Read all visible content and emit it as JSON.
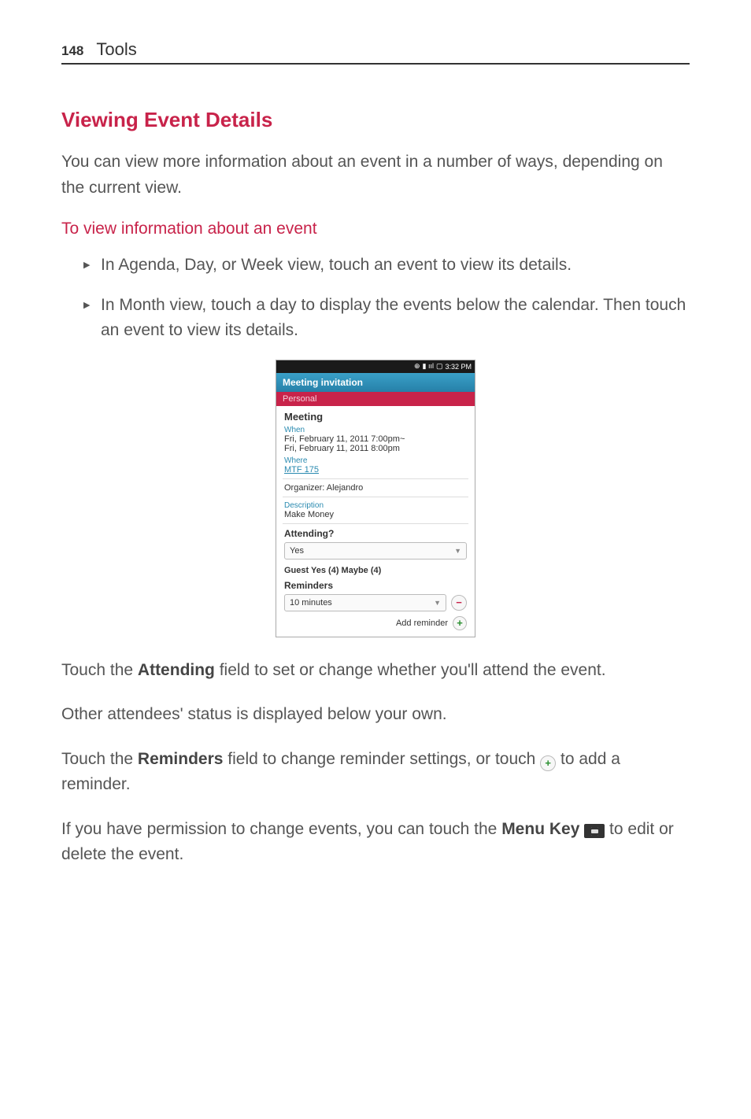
{
  "header": {
    "page_number": "148",
    "section": "Tools"
  },
  "section_heading": "Viewing Event Details",
  "intro_para": "You can view more information about an event in a number of ways, depending on the current view.",
  "sub_heading": "To view information about an event",
  "bullets": [
    "In Agenda, Day, or Week view, touch an event to view its details.",
    "In Month view, touch a day to display the events below the calendar. Then touch an event to view its details."
  ],
  "phone": {
    "status_time": "3:32 PM",
    "title": "Meeting invitation",
    "calendar": "Personal",
    "event_title": "Meeting",
    "when_label": "When",
    "when_line1": "Fri, February 11, 2011 7:00pm~",
    "when_line2": "Fri, February 11, 2011 8:00pm",
    "where_label": "Where",
    "where_value": "MTF 175",
    "organizer": "Organizer: Alejandro",
    "description_label": "Description",
    "description_value": "Make Money",
    "attending_label": "Attending?",
    "attending_value": "Yes",
    "guests_line": "Guest Yes (4) Maybe (4)",
    "reminders_label": "Reminders",
    "reminder_value": "10 minutes",
    "add_reminder": "Add reminder"
  },
  "para_after": {
    "p1_pre": "Touch the ",
    "p1_bold": "Attending",
    "p1_post": " field to set or change whether you'll attend the event.",
    "p2": "Other attendees' status is displayed below your own.",
    "p3_pre": "Touch the ",
    "p3_bold": "Reminders",
    "p3_mid": " field to change reminder settings, or touch ",
    "p3_post": " to add a reminder.",
    "p4_pre": "If you have permission to change events, you can touch the ",
    "p4_bold": "Menu Key",
    "p4_post": " to edit or delete the event."
  }
}
